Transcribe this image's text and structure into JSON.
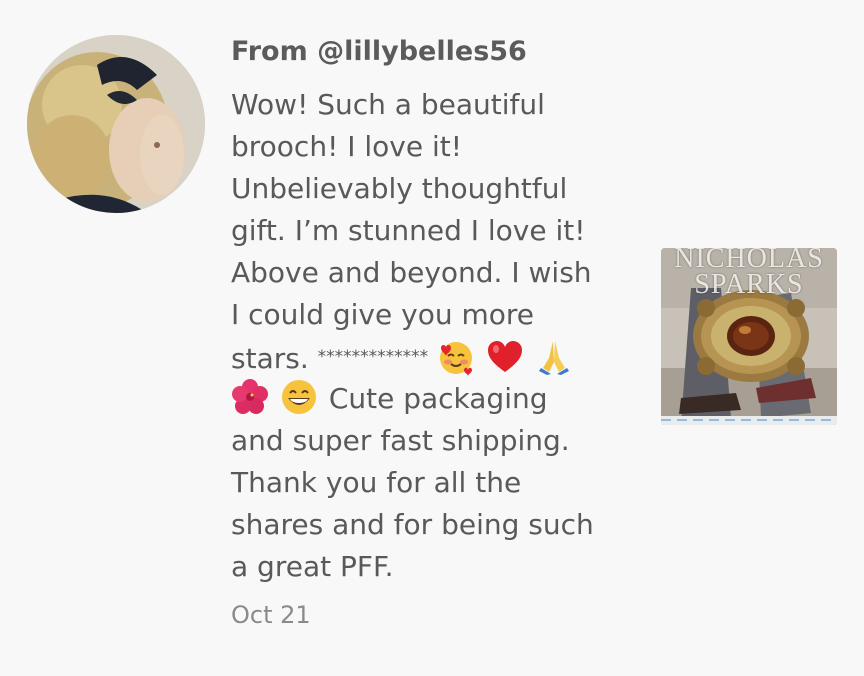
{
  "review": {
    "author": "From @lillybelles56",
    "lines": [
      "Wow! Such a beautiful",
      "brooch! I love it!",
      "Unbelievably thoughtful",
      "gift. I’m stunned I love it!",
      "Above and beyond. I wish",
      "I could give you more"
    ],
    "line7_text": "stars.",
    "line7_stars": "*************",
    "line8_text": "Cute packaging",
    "lines_after": [
      "and super fast shipping.",
      "Thank you for all the",
      "shares and for being such",
      "a great PFF."
    ],
    "emoji_line7": [
      "smiling-face-with-hearts-icon",
      "red-heart-icon",
      "folded-hands-icon"
    ],
    "emoji_line8": [
      "hibiscus-icon",
      "grinning-face-icon"
    ],
    "date": "Oct 21"
  },
  "product_image": {
    "title_line1": "NICHOLAS",
    "title_line2": "SPARKS"
  }
}
